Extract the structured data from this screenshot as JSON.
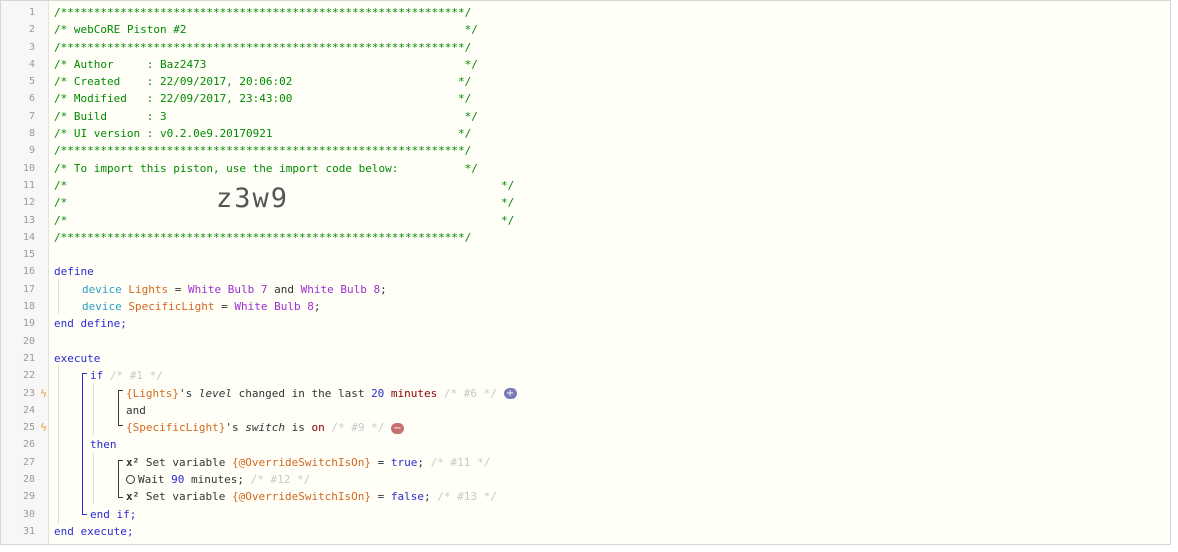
{
  "line_numbers": [
    "1",
    "2",
    "3",
    "4",
    "5",
    "6",
    "7",
    "8",
    "9",
    "10",
    "11",
    "12",
    "13",
    "14",
    "15",
    "16",
    "17",
    "18",
    "19",
    "20",
    "21",
    "22",
    "23",
    "24",
    "25",
    "26",
    "27",
    "28",
    "29",
    "30",
    "31"
  ],
  "header": {
    "stars": "/*************************************************************/",
    "title": "/* webCoRE Piston #2                                          */",
    "author": "/* Author     : Baz2473                                       */",
    "created": "/* Created    : 22/09/2017, 20:06:02                         */",
    "modified": "/* Modified   : 22/09/2017, 23:43:00                         */",
    "build": "/* Build      : 3                                             */",
    "ui_version": "/* UI version : v0.2.0e9.20170921                            */",
    "import_line": "/* To import this piston, use the import code below:          */",
    "blank_open": "/*",
    "blank_close": "*/",
    "import_code": "z3w9"
  },
  "define": {
    "start": "define",
    "end": "end define;",
    "d1_kw": "device",
    "d1_name": "Lights",
    "d1_eq": " = ",
    "d1_val1": "White Bulb 7",
    "d1_and": " and ",
    "d1_val2": "White Bulb 8",
    "d1_semi": ";",
    "d2_kw": "device",
    "d2_name": "SpecificLight",
    "d2_eq": " = ",
    "d2_val": "White Bulb 8",
    "d2_semi": ";"
  },
  "execute": {
    "start": "execute",
    "end": "end execute;",
    "if_kw": "if",
    "if_comment": "/* #1 */",
    "c1_dev": "{Lights}",
    "c1_poss": "'s ",
    "c1_attr": "level",
    "c1_op": " changed in the last ",
    "c1_num": "20",
    "c1_unit": " minutes",
    "c1_comment": "/* #6 */",
    "c1_badge": "+",
    "and": "and",
    "c2_dev": "{SpecificLight}",
    "c2_poss": "'s ",
    "c2_attr": "switch",
    "c2_op": " is ",
    "c2_val": "on",
    "c2_comment": "/* #9 */",
    "c2_badge": "−",
    "then": "then",
    "s1_icon": "x²",
    "s1_text": " Set variable ",
    "s1_var": "{@OverrideSwitchIsOn}",
    "s1_eq": " = ",
    "s1_val": "true",
    "s1_semi": ";",
    "s1_comment": "/* #11 */",
    "s2_text": "Wait ",
    "s2_num": "90",
    "s2_unit": " minutes;",
    "s2_comment": "/* #12 */",
    "s3_icon": "x²",
    "s3_text": " Set variable ",
    "s3_var": "{@OverrideSwitchIsOn}",
    "s3_eq": " = ",
    "s3_val": "false",
    "s3_semi": ";",
    "s3_comment": "/* #13 */",
    "end_if": "end if;"
  },
  "colors": {
    "comment": "#008a00",
    "keyword": "#2b2bd0",
    "device_type": "#2aa0c8",
    "variable": "#d2691e",
    "device_value": "#9b30d0",
    "badge_plus": "#7a7ab8",
    "badge_minus": "#c87070",
    "bolt": "#f0a030"
  },
  "icons": {
    "trigger": "lightning-bolt-icon",
    "set_variable": "x-squared-icon",
    "wait": "clock-icon"
  }
}
